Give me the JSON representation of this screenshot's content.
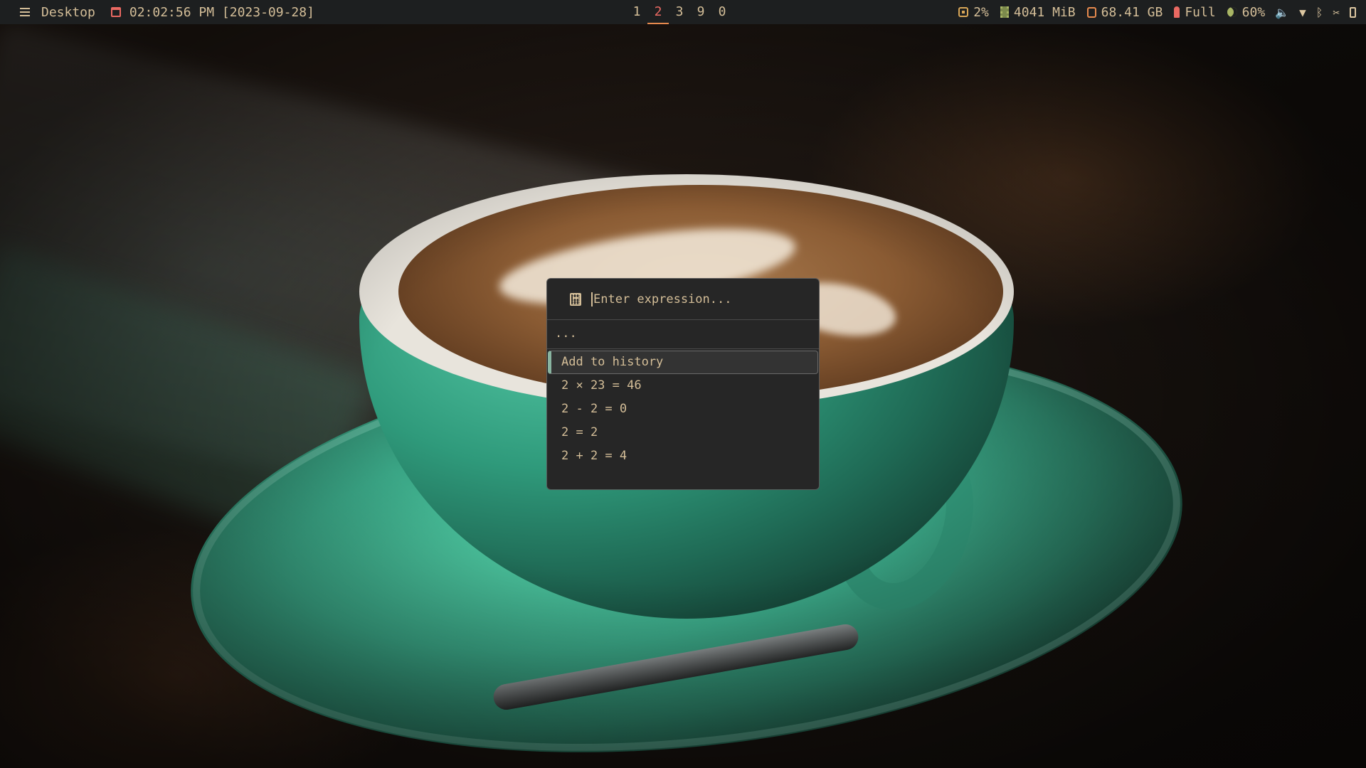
{
  "topbar": {
    "desktop_label": "Desktop",
    "clock": "02:02:56 PM [2023-09-28]",
    "workspaces": [
      {
        "label": "1",
        "active": false
      },
      {
        "label": "2",
        "active": true
      },
      {
        "label": "3",
        "active": false
      },
      {
        "label": "9",
        "active": false
      },
      {
        "label": "0",
        "active": false
      }
    ],
    "cpu": "2%",
    "memory": "4041 MiB",
    "disk": "68.41 GB",
    "battery": "Full",
    "brightness": "60%",
    "icons": {
      "volume": "🔈",
      "wifi": "▼",
      "bluetooth": "ᛒ",
      "tools": "✂"
    },
    "colors": {
      "background": "#1d1f20",
      "foreground": "#d4be98",
      "accent_red": "#ea6962",
      "accent_orange": "#e78a4e",
      "accent_yellow": "#d8a657",
      "accent_green": "#a9b665"
    }
  },
  "launcher": {
    "placeholder": "Enter expression...",
    "result": "...",
    "items": [
      {
        "label": "Add to history",
        "selected": true
      },
      {
        "label": "2 × 23 = 46",
        "selected": false
      },
      {
        "label": "2 - 2 = 0",
        "selected": false
      },
      {
        "label": "2 = 2",
        "selected": false
      },
      {
        "label": "2 + 2 = 4",
        "selected": false
      }
    ]
  }
}
